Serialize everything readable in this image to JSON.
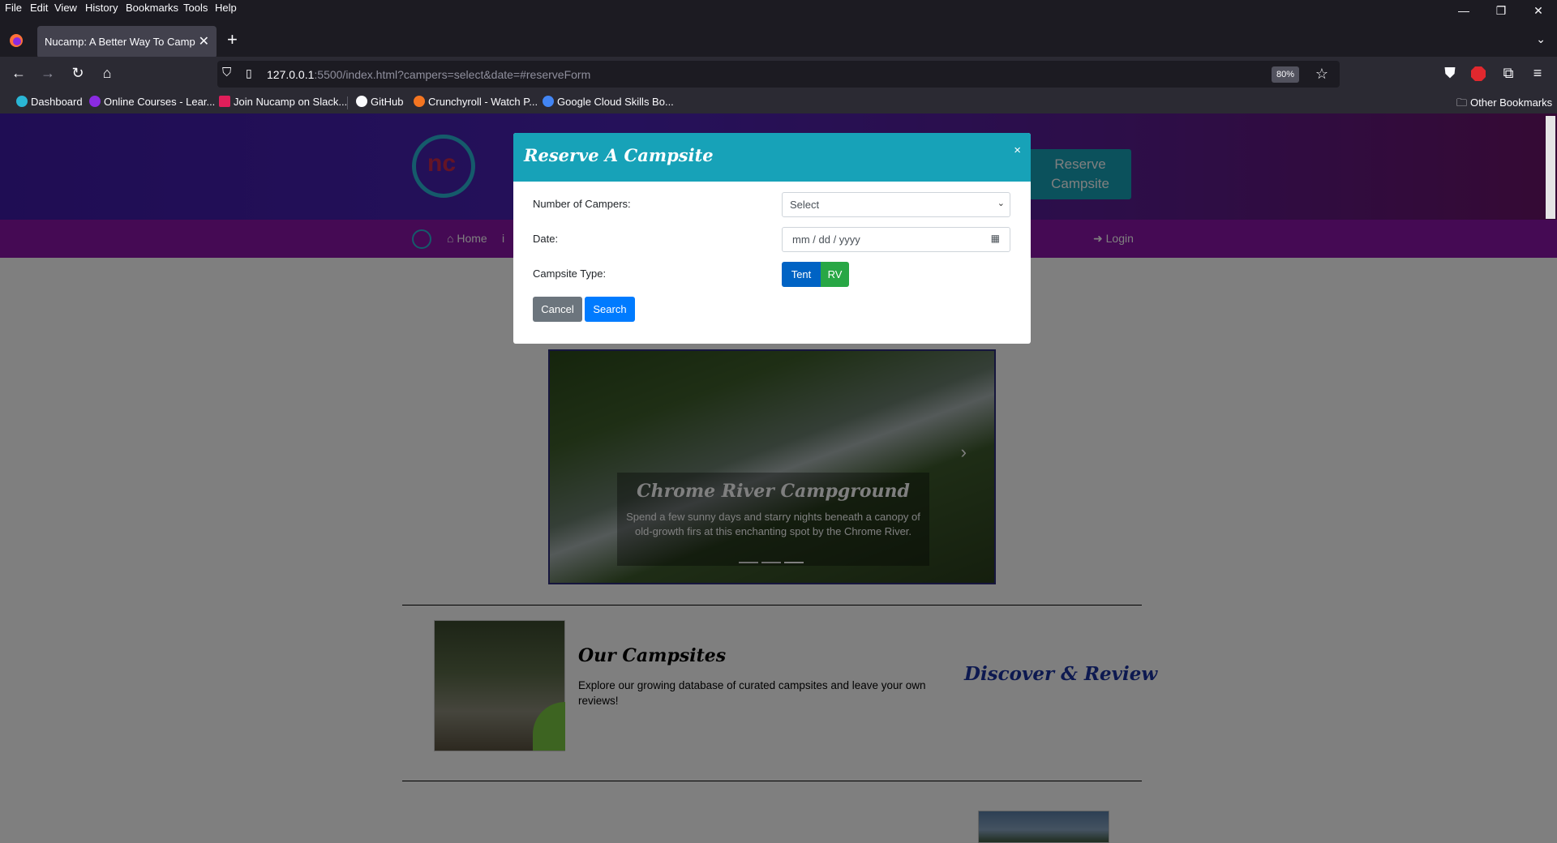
{
  "menu": [
    "File",
    "Edit",
    "View",
    "History",
    "Bookmarks",
    "Tools",
    "Help"
  ],
  "tab": {
    "title": "Nucamp: A Better Way To Camp",
    "close": "✕",
    "new": "+"
  },
  "url": {
    "host": "127.0.0.1",
    "rest": ":5500/index.html?campers=select&date=#reserveForm",
    "zoom": "80%"
  },
  "bookmarks": [
    "Dashboard",
    "Online Courses - Lear...",
    "Join Nucamp on Slack...",
    "GitHub",
    "Crunchyroll - Watch P...",
    "Google Cloud Skills Bo..."
  ],
  "other_bookmarks": "Other Bookmarks",
  "site": {
    "reserve_button": "Reserve Campsite",
    "nav": {
      "home": "Home",
      "login": "Login"
    },
    "carousel": {
      "title": "Chrome River Campground",
      "text": "Spend a few sunny days and starry nights beneath a canopy of old-growth firs at this enchanting spot by the Chrome River."
    },
    "campsites": {
      "title": "Our Campsites",
      "desc": "Explore our growing database of curated campsites and leave your own reviews!",
      "tagline": "Discover & Review"
    }
  },
  "modal": {
    "title": "Reserve A Campsite",
    "close": "×",
    "campers_label": "Number of Campers:",
    "campers_value": "Select",
    "date_label": "Date:",
    "date_placeholder": "mm / dd / yyyy",
    "type_label": "Campsite Type:",
    "tent": "Tent",
    "rv": "RV",
    "cancel": "Cancel",
    "search": "Search"
  },
  "colors": {
    "modal_header": "#17a2b8",
    "tent": "#0063c4",
    "rv": "#28a745",
    "search": "#007bff",
    "cancel": "#6c757d"
  }
}
